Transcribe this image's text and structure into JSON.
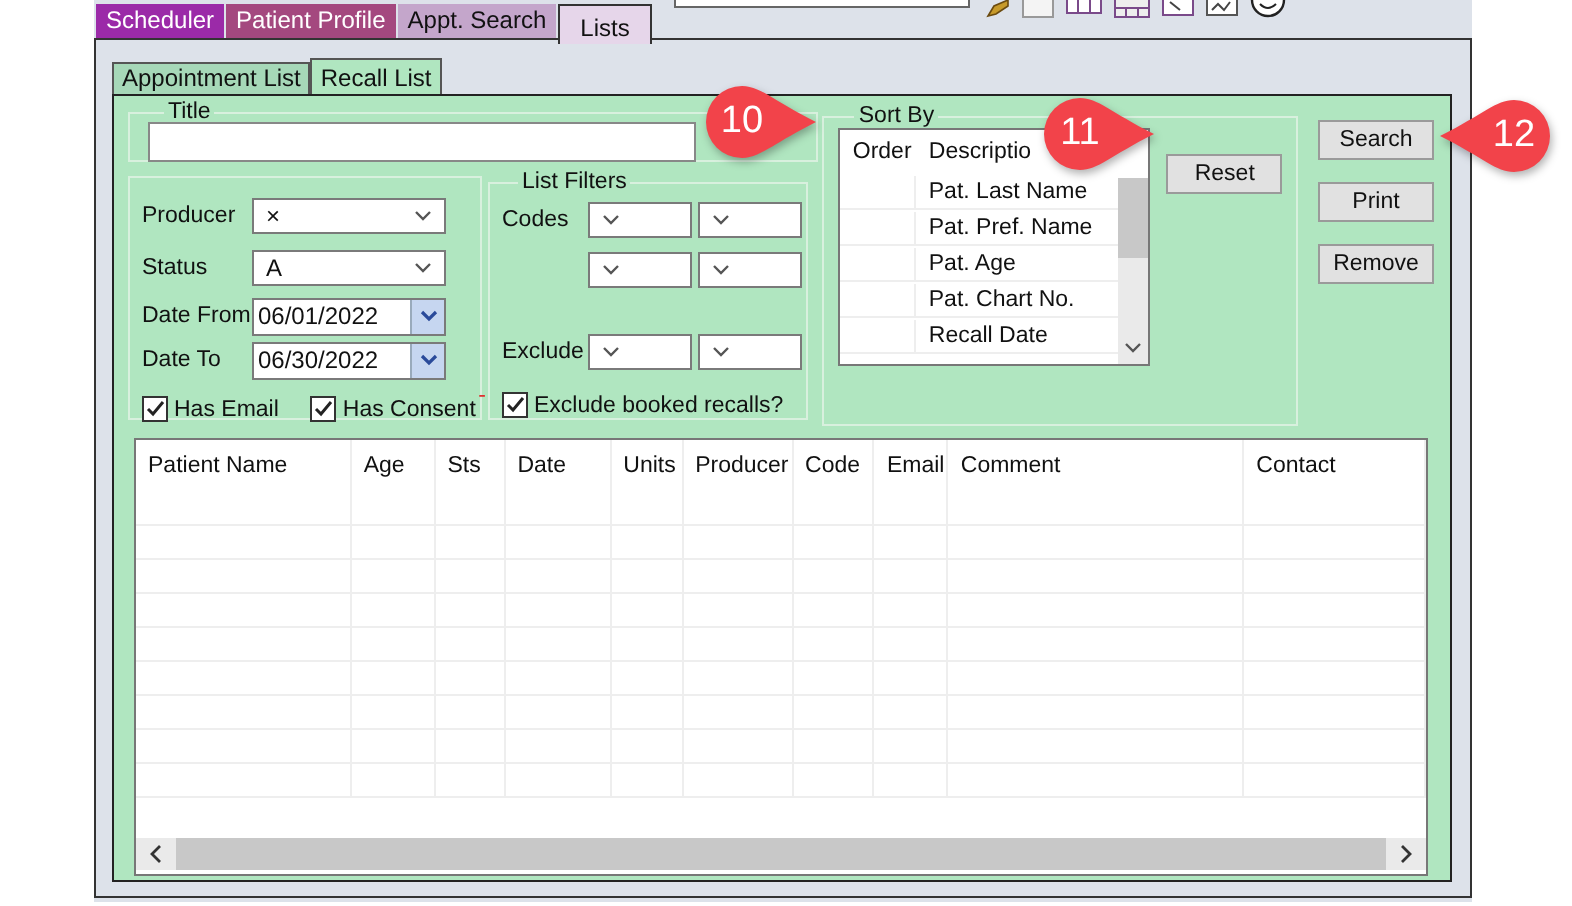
{
  "module_tabs": [
    {
      "label": "Scheduler",
      "selected": false,
      "color": "#9b2aa8"
    },
    {
      "label": "Patient Profile",
      "selected": false,
      "color": "#a4487f"
    },
    {
      "label": "Appt. Search",
      "selected": false,
      "color": "#c4a6cb"
    },
    {
      "label": "Lists",
      "selected": true,
      "color": "#e6d6ea"
    }
  ],
  "sub_tabs": [
    {
      "label": "Appointment List",
      "selected": false
    },
    {
      "label": "Recall List",
      "selected": true
    }
  ],
  "title_field": {
    "label": "Title"
  },
  "criteria": {
    "producer": {
      "label": "Producer",
      "value": "×"
    },
    "status": {
      "label": "Status",
      "value": "A"
    },
    "date_from": {
      "label": "Date From",
      "value": "06/01/2022"
    },
    "date_to": {
      "label": "Date To",
      "value": "06/30/2022"
    },
    "checkboxes": [
      {
        "label": "Has Email",
        "checked": true
      },
      {
        "label": "Has Consent",
        "checked": true
      }
    ],
    "marker": "-"
  },
  "list_filters": {
    "title": "List Filters",
    "codes_label": "Codes",
    "exclude_label": "Exclude",
    "exclude_booked": {
      "label": "Exclude booked recalls?",
      "checked": true
    }
  },
  "sort_by": {
    "title": "Sort By",
    "columns": [
      "Order",
      "Descriptio"
    ],
    "rows": [
      "Pat. Last Name",
      "Pat. Pref. Name",
      "Pat. Age",
      "Pat. Chart No.",
      "Recall Date"
    ],
    "reset_button": "Reset"
  },
  "buttons": [
    "Search",
    "Print",
    "Remove"
  ],
  "results_table": {
    "columns": [
      "Patient Name",
      "Age",
      "Sts",
      "Date",
      "Units",
      "Producer",
      "Code",
      "Email",
      "Comment",
      "Contact"
    ]
  },
  "callouts": [
    "10",
    "11",
    "12"
  ]
}
